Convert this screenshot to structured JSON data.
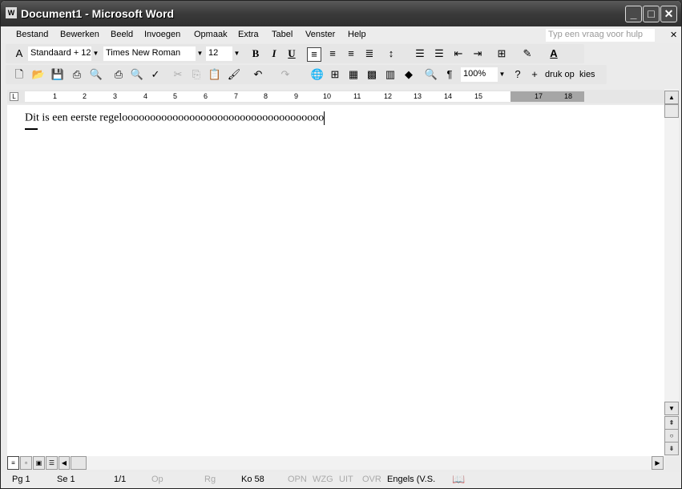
{
  "window": {
    "title": "Document1 - Microsoft Word",
    "app_icon": "word-icon",
    "minimize": "_",
    "maximize": "□",
    "close": "✕"
  },
  "menu": {
    "items": [
      "Bestand",
      "Bewerken",
      "Beeld",
      "Invoegen",
      "Opmaak",
      "Extra",
      "Tabel",
      "Venster",
      "Help"
    ],
    "help_placeholder": "Typ een vraag voor hulp",
    "close": "✕"
  },
  "formatting": {
    "style": "Standaard + 12",
    "font": "Times New Roman",
    "size": "12",
    "bold": "B",
    "italic": "I",
    "underline": "U"
  },
  "standard": {
    "zoom": "100%",
    "plus": "+",
    "druk_op": "druk op",
    "kies": "kies"
  },
  "ruler": {
    "labels": [
      "1",
      "2",
      "3",
      "4",
      "5",
      "6",
      "7",
      "8",
      "9",
      "10",
      "11",
      "12",
      "13",
      "14",
      "15",
      "17",
      "18"
    ]
  },
  "document": {
    "text": "Dit is een eerste regeloooooooooooooooooooooooooooooooooooo"
  },
  "status": {
    "page": "Pg 1",
    "section": "Se 1",
    "pages": "1/1",
    "at": "Op",
    "line": "Rg",
    "col": "Ko 58",
    "rec": "OPN",
    "trk": "WZG",
    "ext": "UIT",
    "ovr": "OVR",
    "language": "Engels (V.S."
  }
}
